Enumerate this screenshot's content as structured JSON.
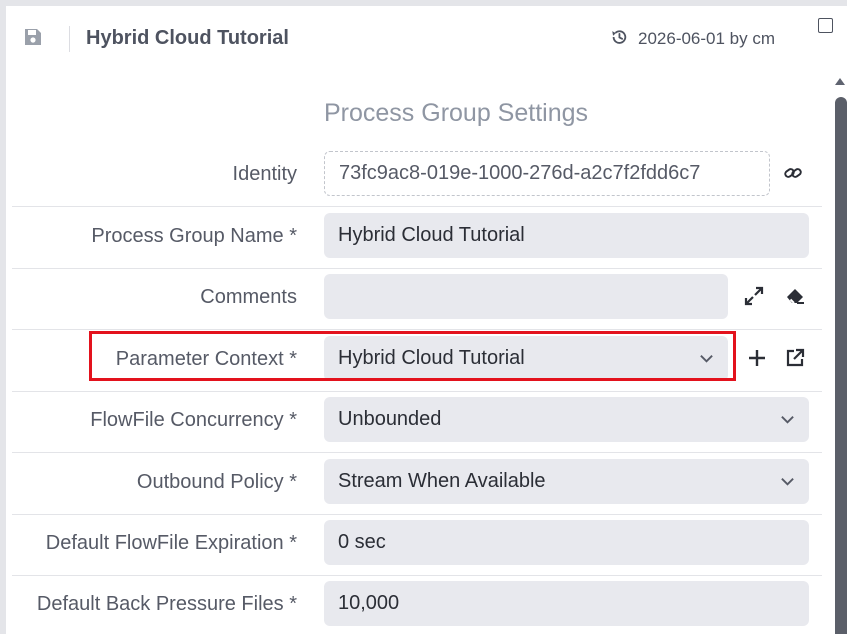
{
  "header": {
    "title": "Hybrid Cloud Tutorial",
    "meta": "2026-06-01 by cm"
  },
  "section_title": "Process Group Settings",
  "form": {
    "identity": {
      "label": "Identity",
      "value": "73fc9ac8-019e-1000-276d-a2c7f2fdd6c7"
    },
    "name": {
      "label": "Process Group Name *",
      "value": "Hybrid Cloud Tutorial"
    },
    "comments": {
      "label": "Comments",
      "value": ""
    },
    "parameter_context": {
      "label": "Parameter Context *",
      "value": "Hybrid Cloud Tutorial"
    },
    "concurrency": {
      "label": "FlowFile Concurrency *",
      "value": "Unbounded"
    },
    "outbound_policy": {
      "label": "Outbound Policy *",
      "value": "Stream When Available"
    },
    "expiration": {
      "label": "Default FlowFile Expiration *",
      "value": "0 sec"
    },
    "back_pressure": {
      "label": "Default Back Pressure Files *",
      "value": "10,000"
    }
  },
  "colors": {
    "highlight": "#e3121d",
    "field_bg": "#e8e9ee",
    "label": "#565a66",
    "section_title": "#8f96a3"
  },
  "icons": {
    "save": "floppy-disk-icon",
    "history": "history-icon",
    "link": "link-icon",
    "expand": "expand-icon",
    "eraser": "eraser-icon",
    "add": "plus-icon",
    "open": "external-link-icon",
    "chevron": "chevron-down-icon"
  }
}
